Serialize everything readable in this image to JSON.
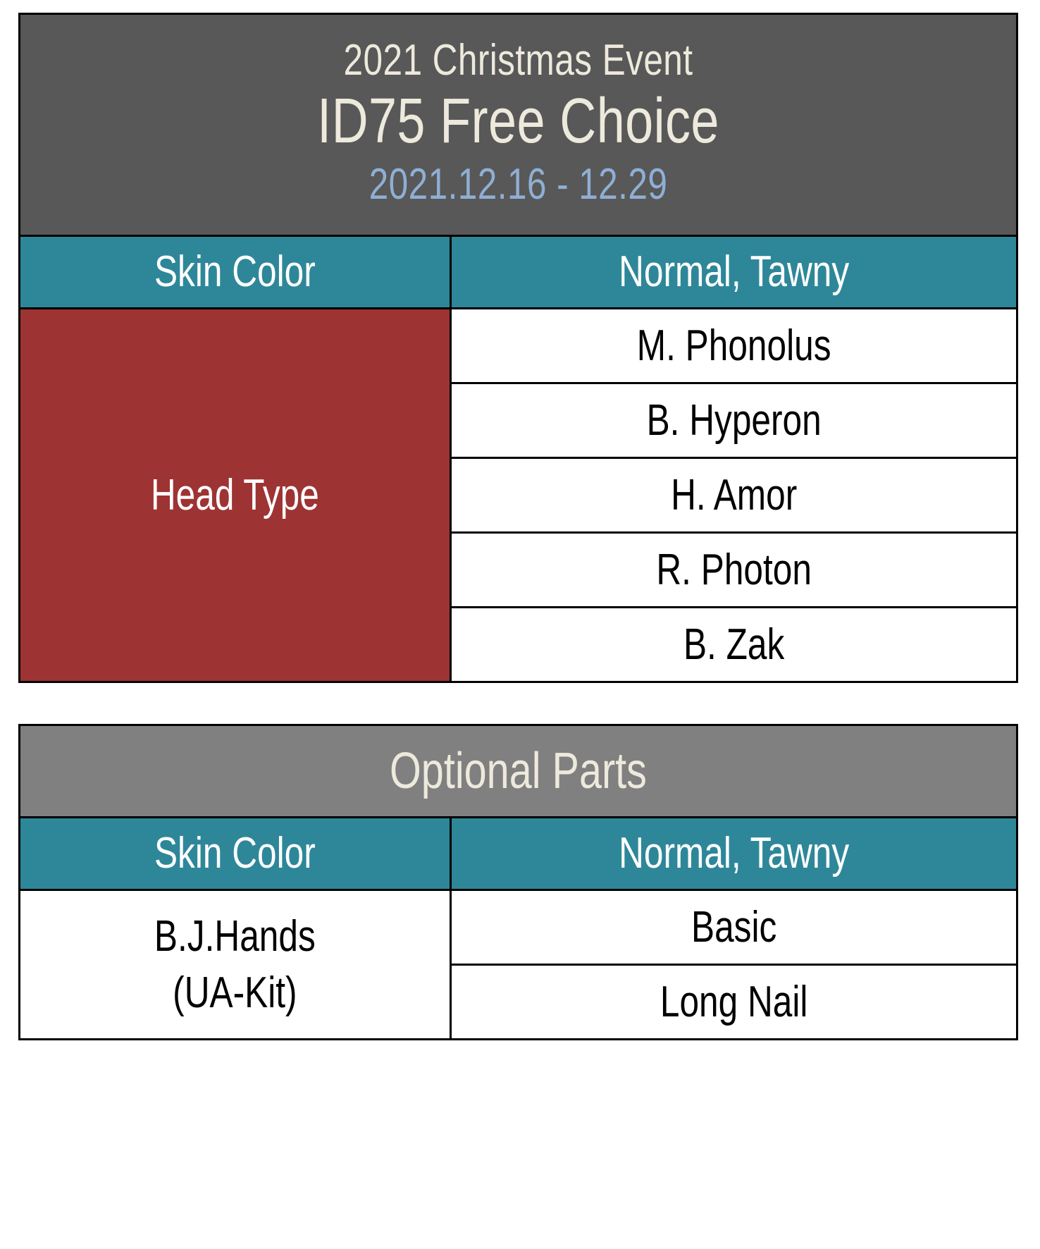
{
  "colors": {
    "title_bg": "#585858",
    "banner_bg": "#808080",
    "header_bg": "#2E8799",
    "rowlabel_bg": "#9E3333",
    "cell_bg": "#FFFFFF",
    "title_text": "#EDE9DC",
    "date_text": "#8FAFD4",
    "header_text": "#FFFFFF",
    "body_text": "#000000",
    "border": "#000000"
  },
  "main_table": {
    "title": {
      "subtitle": "2021 Christmas Event",
      "heading": "ID75 Free Choice",
      "date_range": "2021.12.16 - 12.29"
    },
    "header": {
      "left": "Skin Color",
      "right": "Normal, Tawny"
    },
    "row_group": {
      "label": "Head Type",
      "options": [
        "M. Phonolus",
        "B. Hyperon",
        "H. Amor",
        "R. Photon",
        "B. Zak"
      ]
    }
  },
  "optional_table": {
    "banner": "Optional Parts",
    "header": {
      "left": "Skin Color",
      "right": "Normal, Tawny"
    },
    "row_group": {
      "label_line1": "B.J.Hands",
      "label_line2": "(UA-Kit)",
      "options": [
        "Basic",
        "Long Nail"
      ]
    }
  }
}
